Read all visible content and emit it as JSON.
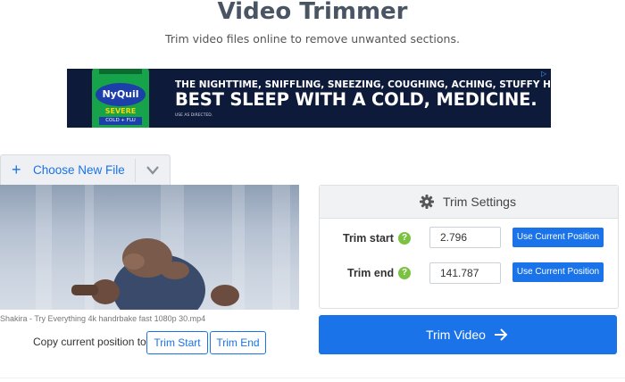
{
  "page": {
    "title": "Video Trimmer",
    "subtitle": "Trim video files online to remove unwanted sections."
  },
  "ad": {
    "brand": "NyQuil",
    "variant": "SEVERE",
    "variant_sub": "COLD + FLU",
    "headline_small": "THE NIGHTTIME, SNIFFLING, SNEEZING, COUGHING, ACHING, STUFFY HEAD,",
    "headline_large": "BEST SLEEP WITH A COLD, MEDICINE.",
    "fine_print": "USE AS DIRECTED.",
    "choices_icon": "adchoices-icon"
  },
  "file_chooser": {
    "label": "Choose New File",
    "icon": "plus-icon",
    "dropdown_icon": "chevron-down-icon"
  },
  "video": {
    "filename": "Shakira - Try Everything 4k handrbake fast 1080p 30.mp4"
  },
  "copy_position": {
    "label": "Copy current position to:",
    "trim_start_button": "Trim Start",
    "trim_end_button": "Trim End"
  },
  "trim_settings": {
    "title": "Trim Settings",
    "icon": "gear-icon",
    "fields": [
      {
        "label": "Trim start",
        "help": "?",
        "value": "2.796",
        "button": "Use Current Position"
      },
      {
        "label": "Trim end",
        "help": "?",
        "value": "141.787",
        "button": "Use Current Position"
      }
    ]
  },
  "action": {
    "label": "Trim Video",
    "icon": "arrow-right-icon"
  },
  "colors": {
    "primary": "#1a73e8",
    "help_badge": "#7cc242",
    "title": "#4a5563",
    "ad_background": "#0e1a3a"
  }
}
